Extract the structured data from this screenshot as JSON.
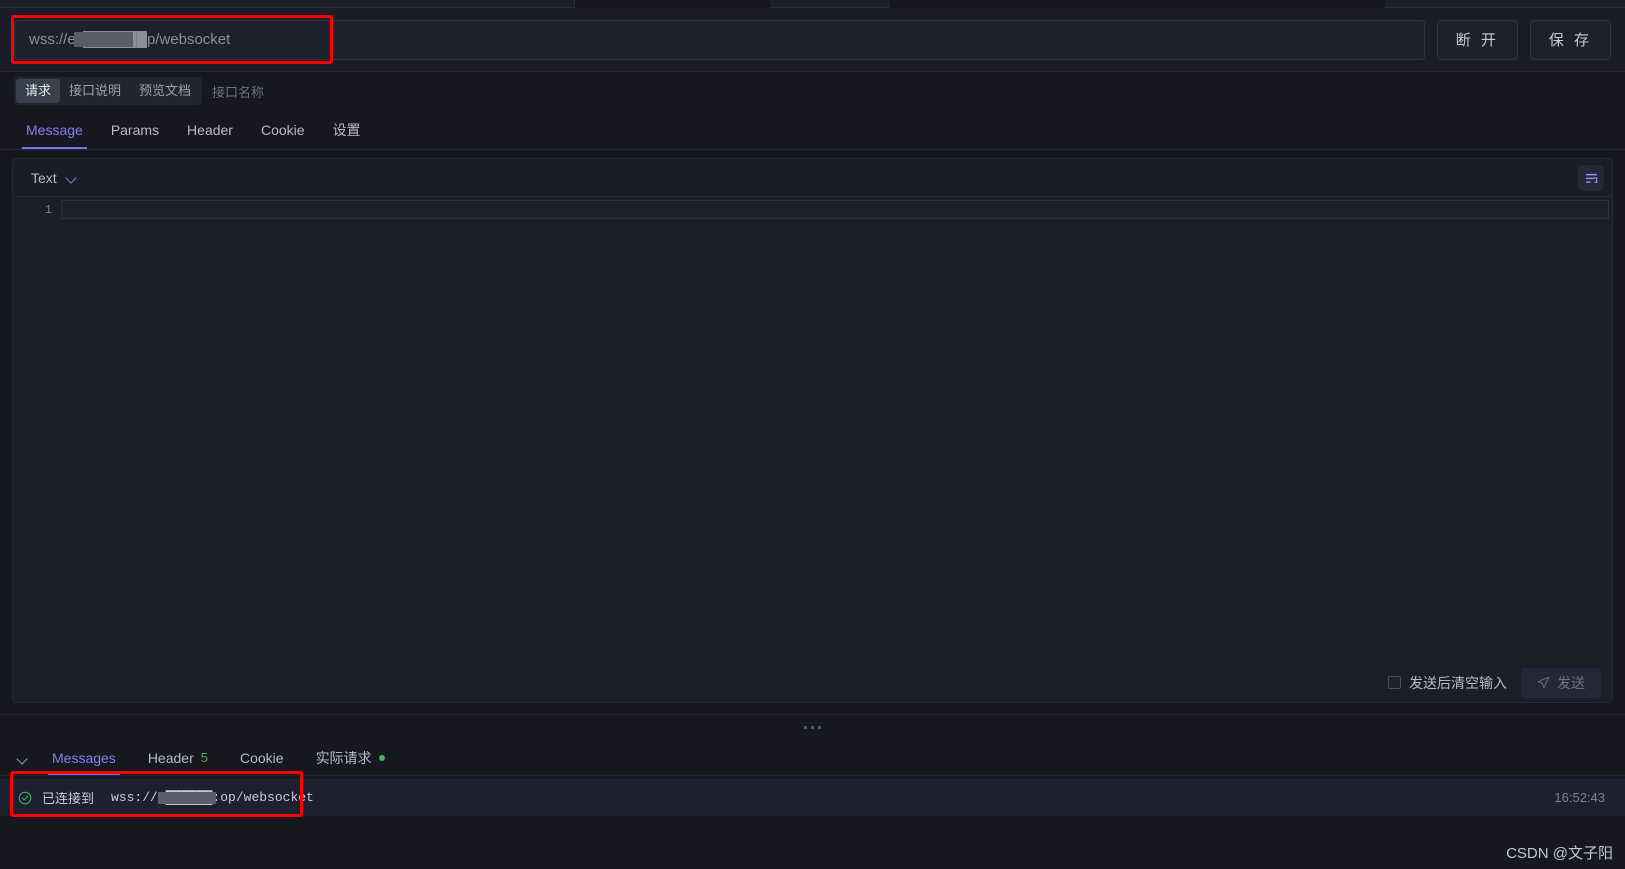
{
  "url_bar": {
    "value": "wss://ec██████p/websocket",
    "placeholder": "wss://ec██████p/websocket",
    "disconnect_label": "断 开",
    "save_label": "保 存"
  },
  "segmented": {
    "items": [
      {
        "label": "请求",
        "active": true
      },
      {
        "label": "接口说明",
        "active": false
      },
      {
        "label": "预览文档",
        "active": false
      }
    ],
    "interface_name_placeholder": "接口名称"
  },
  "main_tabs": [
    {
      "label": "Message",
      "active": true
    },
    {
      "label": "Params",
      "active": false
    },
    {
      "label": "Header",
      "active": false
    },
    {
      "label": "Cookie",
      "active": false
    },
    {
      "label": "设置",
      "active": false
    }
  ],
  "editor": {
    "type_label": "Text",
    "format_icon": "format-lines-icon",
    "line_number": "1",
    "content": ""
  },
  "send_bar": {
    "clear_after_send_label": "发送后清空输入",
    "clear_after_send_checked": false,
    "send_label": "发送",
    "send_icon": "paper-plane-icon"
  },
  "bottom_tabs": [
    {
      "label": "Messages",
      "count": "",
      "active": true,
      "dot": false
    },
    {
      "label": "Header",
      "count": "5",
      "active": false,
      "dot": false
    },
    {
      "label": "Cookie",
      "count": "",
      "active": false,
      "dot": false
    },
    {
      "label": "实际请求",
      "count": "",
      "active": false,
      "dot": true
    }
  ],
  "messages": [
    {
      "status_icon": "check-circle-icon",
      "text": "已连接到",
      "url": "wss://c██████:op/websocket",
      "time": "16:52:43"
    }
  ],
  "colors": {
    "accent": "#7c6df0",
    "success": "#41b35d",
    "highlight_box": "#ff0000",
    "background": "#16171f"
  },
  "watermark": "CSDN @文子阳"
}
